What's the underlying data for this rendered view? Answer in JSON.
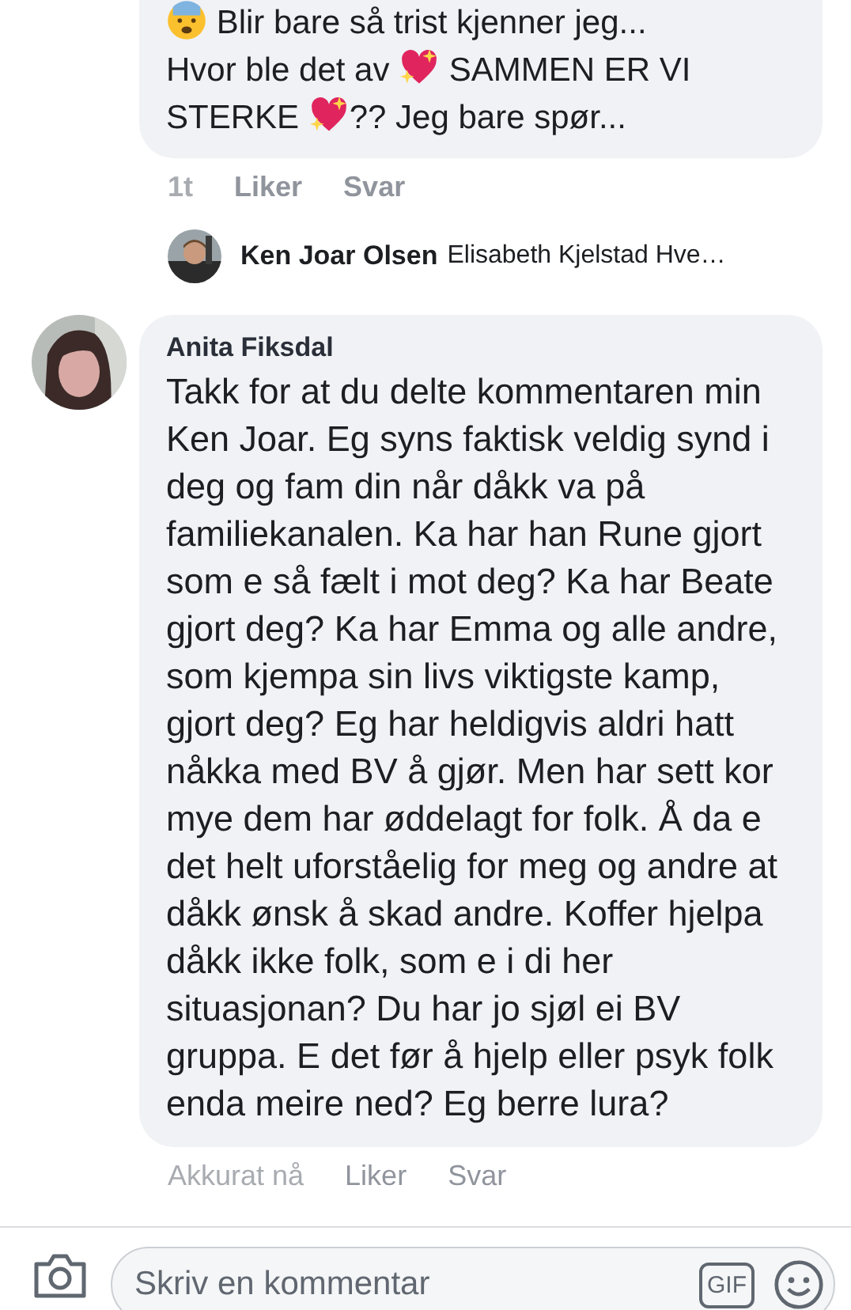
{
  "previous_comment": {
    "segments": [
      {
        "kind": "face"
      },
      {
        "kind": "text",
        "text": " Blir bare så trist kjenner jeg..."
      },
      {
        "kind": "break"
      },
      {
        "kind": "text",
        "text": "Hvor ble det av "
      },
      {
        "kind": "heart"
      },
      {
        "kind": "text",
        "text": " SAMMEN ER VI"
      },
      {
        "kind": "break"
      },
      {
        "kind": "text",
        "text": "STERKE "
      },
      {
        "kind": "heart"
      },
      {
        "kind": "text",
        "text": "??  Jeg bare spør..."
      }
    ],
    "time": "1t",
    "like": "Liker",
    "reply": "Svar"
  },
  "reply_preview": {
    "author": "Ken Joar Olsen",
    "text": "Elisabeth Kjelstad Hve…"
  },
  "comment": {
    "author": "Anita Fiksdal",
    "text": "Takk for at du delte kommentaren min Ken Joar. Eg syns faktisk veldig synd i deg og fam din når dåkk va på familiekanalen. Ka har han Rune gjort som e så fælt i mot deg? Ka har Beate gjort deg? Ka har Emma og alle andre, som kjempa sin livs viktigste kamp, gjort deg? Eg har heldigvis aldri hatt nåkka med BV å gjør. Men har sett kor mye dem har øddelagt for folk. Å da e det helt uforståelig for meg og andre at dåkk ønsk å skad andre. Koffer hjelpa dåkk ikke folk, som e i di her situasjonan? Du har jo sjøl ei BV gruppa. E det før å hjelp eller psyk folk enda meire ned? Eg berre lura?",
    "time": "Akkurat nå",
    "like": "Liker",
    "reply": "Svar"
  },
  "composer": {
    "placeholder": "Skriv en kommentar",
    "gif": "GIF"
  }
}
